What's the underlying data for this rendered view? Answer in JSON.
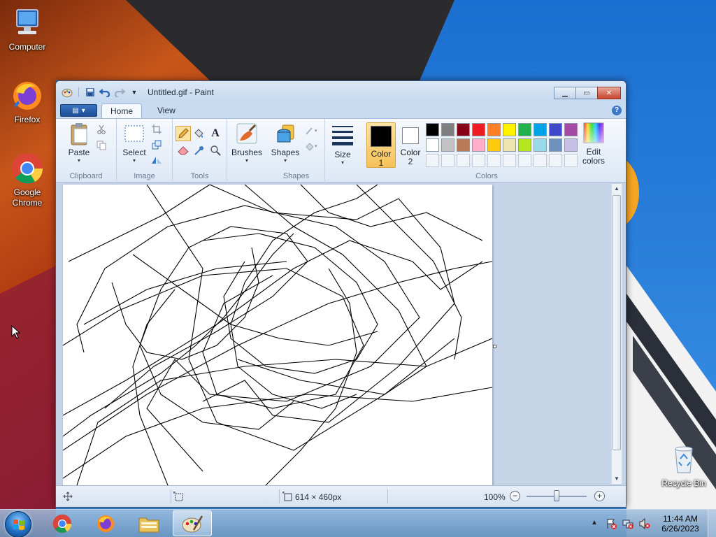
{
  "desktop": {
    "icons": [
      {
        "label": "Computer"
      },
      {
        "label": "Firefox"
      },
      {
        "label": "Google Chrome"
      },
      {
        "label": "Recycle Bin"
      }
    ]
  },
  "window": {
    "title": "Untitled.gif - Paint",
    "tabs": [
      {
        "label": "Home"
      },
      {
        "label": "View"
      }
    ]
  },
  "ribbon": {
    "groups": {
      "clipboard": "Clipboard",
      "image": "Image",
      "tools": "Tools",
      "shapes": "Shapes",
      "colors": "Colors"
    },
    "buttons": {
      "paste": "Paste",
      "select": "Select",
      "brushes": "Brushes",
      "shapes": "Shapes",
      "size": "Size",
      "color1_line1": "Color",
      "color1_line2": "1",
      "color2_line1": "Color",
      "color2_line2": "2",
      "edit_colors_line1": "Edit",
      "edit_colors_line2": "colors"
    },
    "palette_row1": [
      "#000000",
      "#7f7f7f",
      "#880015",
      "#ed1c24",
      "#ff7f27",
      "#fff200",
      "#22b14c",
      "#00a2e8",
      "#3f48cc",
      "#a349a4"
    ],
    "palette_row2": [
      "#ffffff",
      "#c3c3c3",
      "#b97a57",
      "#ffaec9",
      "#ffc90e",
      "#efe4b0",
      "#b5e61d",
      "#99d9ea",
      "#7092be",
      "#c8bfe7"
    ]
  },
  "status": {
    "image_size": "614 × 460px",
    "zoom": "100%"
  },
  "taskbar": {
    "time": "11:44 AM",
    "date": "6/26/2023"
  }
}
